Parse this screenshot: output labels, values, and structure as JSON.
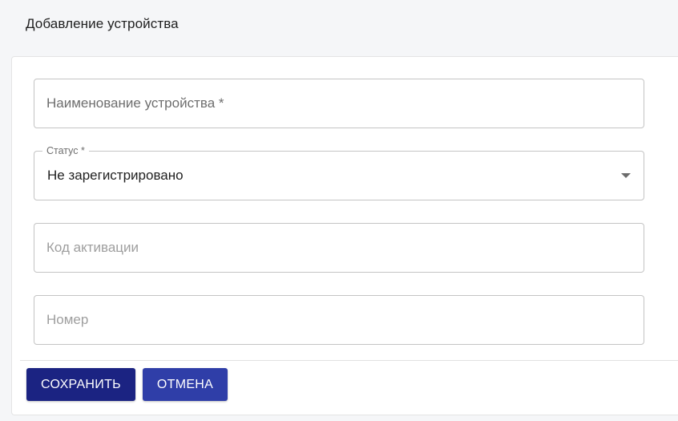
{
  "header": {
    "title": "Добавление устройства"
  },
  "form": {
    "name_placeholder": "Наименование устройства *",
    "status_label": "Статус *",
    "status_value": "Не зарегистрировано",
    "activation_placeholder": "Код активации",
    "number_placeholder": "Номер"
  },
  "actions": {
    "save_label": "СОХРАНИТЬ",
    "cancel_label": "ОТМЕНА"
  },
  "colors": {
    "save_button": "#1b2382",
    "cancel_button": "#2f3ea8",
    "page_background": "#f5f6f8"
  },
  "icons": {
    "status_dropdown": "caret-down-icon"
  }
}
